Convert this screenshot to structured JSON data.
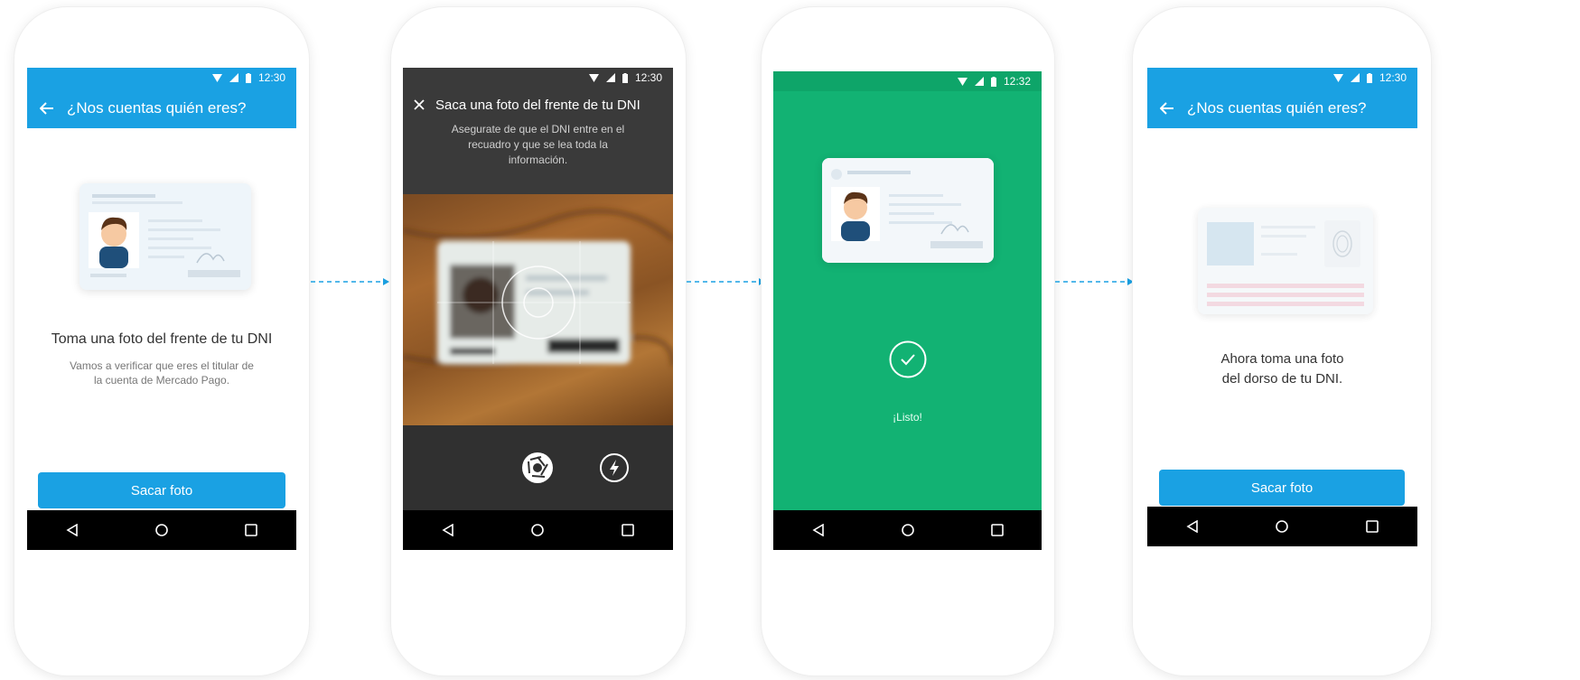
{
  "colors": {
    "brand_blue": "#1aa1e3",
    "success_green": "#12b273",
    "dark_camera": "#3a3a3a",
    "nav_black": "#000000"
  },
  "screens": [
    {
      "status_time": "12:30",
      "appbar_title": "¿Nos cuentas quién eres?",
      "heading": "Toma una foto del frente de tu DNI",
      "subtext": "Vamos a verificar que eres el titular de la cuenta de Mercado Pago.",
      "button_label": "Sacar foto"
    },
    {
      "status_time": "12:30",
      "title": "Saca una foto del frente de tu DNI",
      "instructions": "Asegurate de que el DNI entre en el recuadro y que se lea toda la información."
    },
    {
      "status_time": "12:32",
      "success_label": "¡Listo!"
    },
    {
      "status_time": "12:30",
      "appbar_title": "¿Nos cuentas quién eres?",
      "heading": "Ahora toma una foto del dorso de tu DNI.",
      "button_label": "Sacar foto"
    }
  ],
  "icons": [
    "back-arrow-icon",
    "close-icon",
    "shutter-icon",
    "flash-icon",
    "check-icon",
    "nav-back-icon",
    "nav-home-icon",
    "nav-recents-icon",
    "wifi-icon",
    "signal-icon",
    "battery-icon"
  ]
}
